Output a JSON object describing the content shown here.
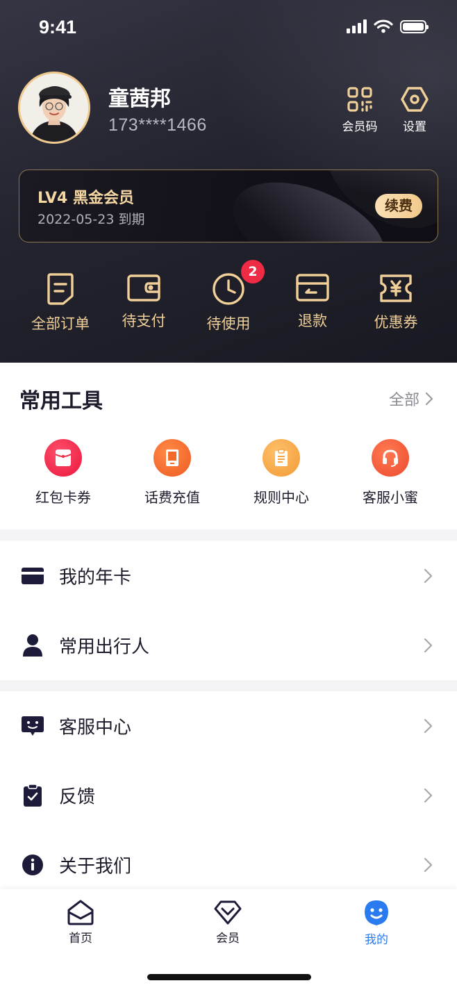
{
  "status_bar": {
    "time": "9:41"
  },
  "profile": {
    "name": "童茜邦",
    "phone": "173****1466",
    "member_code_label": "会员码",
    "settings_label": "设置"
  },
  "membership": {
    "level": "LV4 黑金会员",
    "expiry": "2022-05-23 到期",
    "renew_label": "续费"
  },
  "orders": {
    "items": [
      {
        "label": "全部订单",
        "icon": "document-icon"
      },
      {
        "label": "待支付",
        "icon": "wallet-icon"
      },
      {
        "label": "待使用",
        "icon": "clock-icon",
        "badge": "2"
      },
      {
        "label": "退款",
        "icon": "refund-icon"
      },
      {
        "label": "优惠券",
        "icon": "coupon-icon"
      }
    ]
  },
  "tools": {
    "title": "常用工具",
    "all_label": "全部",
    "items": [
      {
        "label": "红包卡券",
        "icon": "red-packet-icon",
        "color": "#f0244a"
      },
      {
        "label": "话费充值",
        "icon": "phone-recharge-icon",
        "color": "#f46a2a"
      },
      {
        "label": "规则中心",
        "icon": "clipboard-icon",
        "color": "#f5a642"
      },
      {
        "label": "客服小蜜",
        "icon": "headset-icon",
        "color": "#f25b3a"
      }
    ]
  },
  "menu_group_1": [
    {
      "label": "我的年卡",
      "icon": "card-icon"
    },
    {
      "label": "常用出行人",
      "icon": "person-icon"
    }
  ],
  "menu_group_2": [
    {
      "label": "客服中心",
      "icon": "chat-smile-icon"
    },
    {
      "label": "反馈",
      "icon": "feedback-icon"
    },
    {
      "label": "关于我们",
      "icon": "info-icon"
    }
  ],
  "tabbar": {
    "items": [
      {
        "label": "首页",
        "icon": "home-icon"
      },
      {
        "label": "会员",
        "icon": "diamond-icon"
      },
      {
        "label": "我的",
        "icon": "smile-user-icon",
        "active": true
      }
    ],
    "active_color": "#2a7bf0"
  },
  "colors": {
    "gold": "#f0cf98",
    "dark": "#1c1b2b",
    "badge": "#ee2a45"
  }
}
